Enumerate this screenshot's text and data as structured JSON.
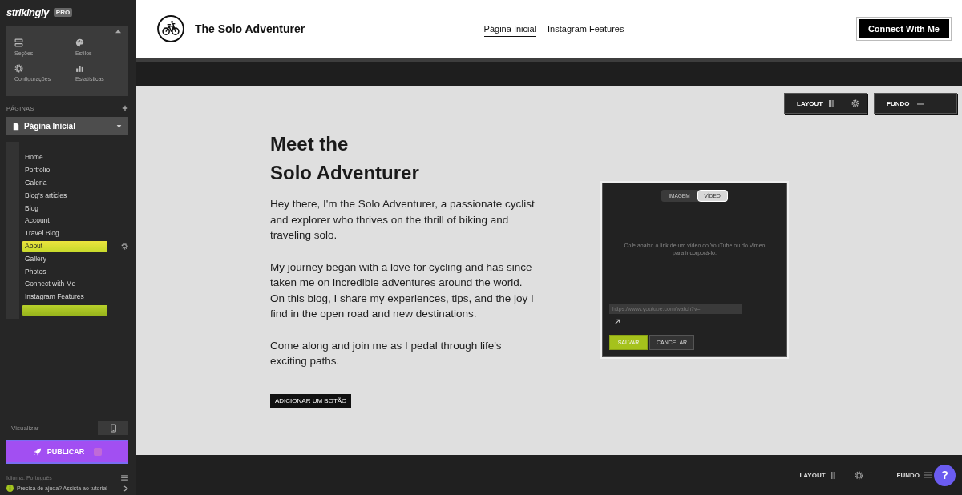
{
  "sidebar": {
    "logo": "strikingly",
    "badge": "PRO",
    "tools": [
      {
        "label": "Seções",
        "kind": "sections"
      },
      {
        "label": "Estilos",
        "kind": "styles"
      },
      {
        "label": "Configurações",
        "kind": "settings"
      },
      {
        "label": "Estatísticas",
        "kind": "stats"
      }
    ],
    "pages_label": "PÁGINAS",
    "current_page": "Página Inicial",
    "pages": [
      {
        "label": "Home",
        "selected": false
      },
      {
        "label": "Portfolio",
        "selected": false
      },
      {
        "label": "Galeria",
        "selected": false
      },
      {
        "label": "Blog's articles",
        "selected": false
      },
      {
        "label": "Blog",
        "selected": false
      },
      {
        "label": "Account",
        "selected": false
      },
      {
        "label": "Travel Blog",
        "selected": false
      },
      {
        "label": "About",
        "selected": true
      },
      {
        "label": "Gallery",
        "selected": false
      },
      {
        "label": "Photos",
        "selected": false
      },
      {
        "label": "Connect with Me",
        "selected": false
      },
      {
        "label": "Instagram Features",
        "selected": false
      }
    ],
    "drop_zone": true,
    "preview": "Visualizar",
    "publish": "PUBLICAR",
    "footer": [
      "Idioma: Português",
      "Precisa de ajuda? Assista ao tutorial"
    ]
  },
  "site": {
    "title": "The Solo Adventurer",
    "nav": [
      {
        "label": "Página Inicial",
        "selected": true
      },
      {
        "label": "Instagram Features",
        "selected": false
      }
    ],
    "cta": "Connect With Me"
  },
  "section_controls": [
    "LAYOUT",
    "FUNDO"
  ],
  "content": {
    "heading": [
      "Meet the",
      "Solo Adventurer"
    ],
    "paragraphs": [
      "Hey there, I'm the Solo Adventurer, a passionate cyclist and explorer who thrives on the thrill of biking and traveling solo.",
      "My journey began with a love for cycling and has since taken me on incredible adventures around the world. On this blog, I share my experiences, tips, and the joy I find in the open road and new destinations.",
      "Come along and join me as I pedal through life's exciting paths."
    ],
    "button": "ADICIONAR UM BOTÃO"
  },
  "media_editor": {
    "tabs": [
      {
        "label": "IMAGEM",
        "selected": false
      },
      {
        "label": "VÍDEO",
        "selected": true
      }
    ],
    "message": "Cole abaixo o link de um vídeo do YouTube ou do Vimeo para incorporá-lo.",
    "url_placeholder": "https://www.youtube.com/watch?v=",
    "buttons": [
      {
        "label": "SALVAR",
        "kind": "primary"
      },
      {
        "label": "CANCELAR",
        "kind": "secondary"
      }
    ]
  },
  "bottom_bar": {
    "controls": [
      "LAYOUT",
      "FUNDO"
    ],
    "help": "?"
  }
}
